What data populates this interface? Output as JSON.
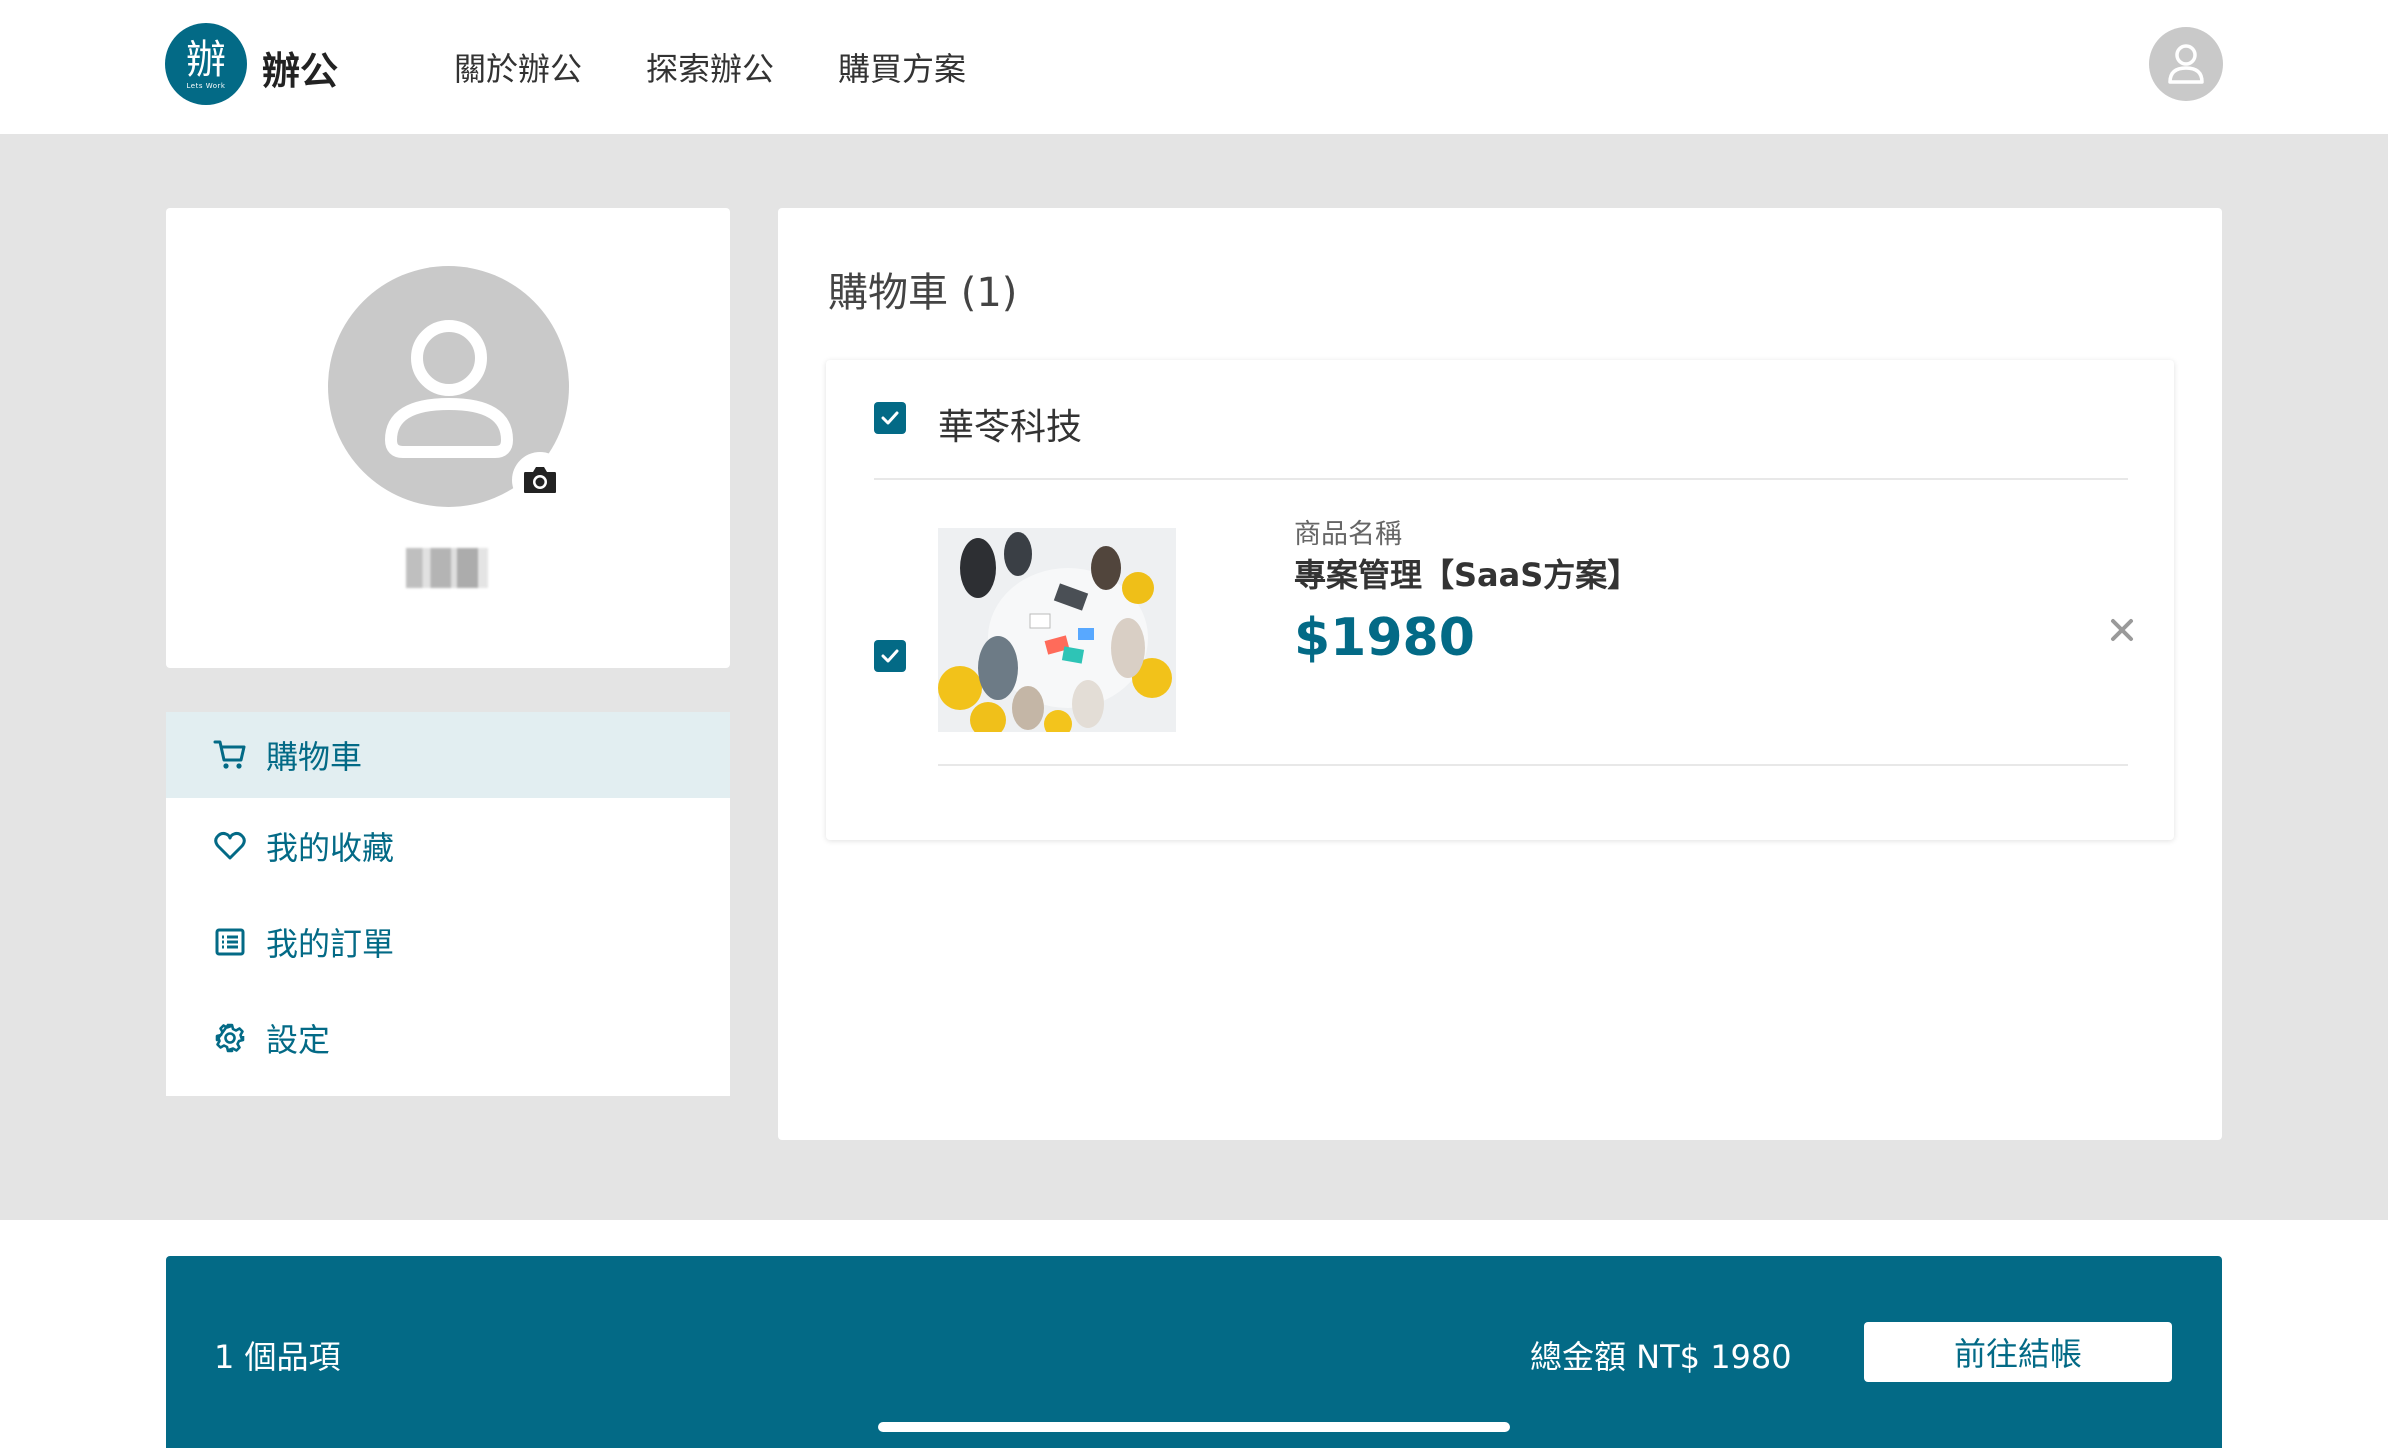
{
  "header": {
    "logo_glyph": "辦",
    "logo_sub": "Lets Work",
    "brand": "辦公",
    "nav": [
      "關於辦公",
      "探索辦公",
      "購買方案"
    ]
  },
  "side_menu": {
    "items": [
      {
        "label": "購物車",
        "icon": "cart-icon",
        "active": true
      },
      {
        "label": "我的收藏",
        "icon": "heart-icon",
        "active": false
      },
      {
        "label": "我的訂單",
        "icon": "list-icon",
        "active": false
      },
      {
        "label": "設定",
        "icon": "gear-icon",
        "active": false
      }
    ]
  },
  "cart": {
    "title": "購物車 (1)",
    "vendor": {
      "name": "華苓科技",
      "checked": true
    },
    "item": {
      "label": "商品名稱",
      "name": "專案管理【SaaS方案】",
      "price": "$1980",
      "checked": true
    }
  },
  "checkout": {
    "item_count": "1 個品項",
    "total": "總金額 NT$ 1980",
    "button": "前往結帳"
  },
  "colors": {
    "accent": "#036a86",
    "background": "#e4e4e4",
    "active_menu_bg": "#e2eef1"
  }
}
